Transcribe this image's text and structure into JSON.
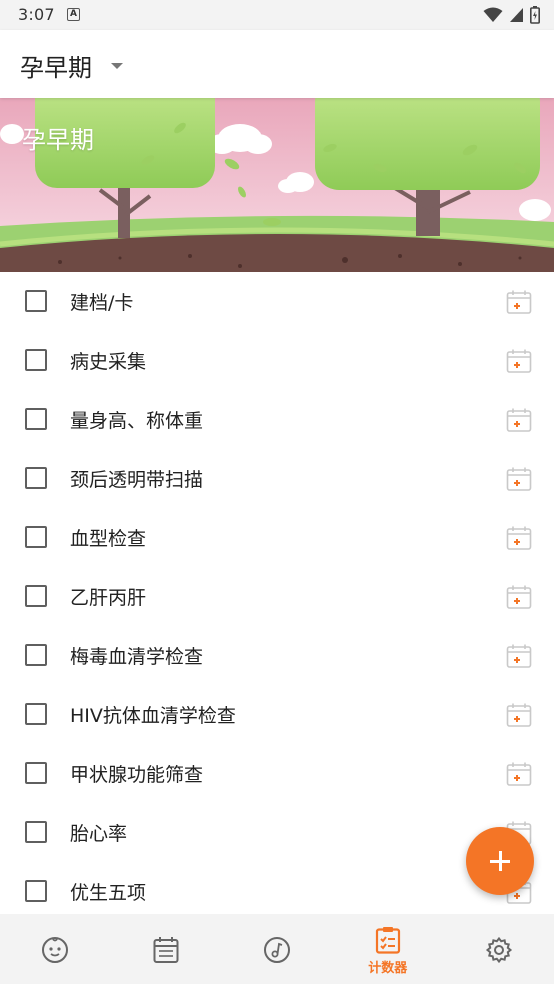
{
  "status_bar": {
    "time": "3:07",
    "notification_icon": "A"
  },
  "app_bar": {
    "period_label": "孕早期"
  },
  "banner": {
    "title": "孕早期"
  },
  "checklist": {
    "items": [
      {
        "label": "建档/卡",
        "checked": false
      },
      {
        "label": "病史采集",
        "checked": false
      },
      {
        "label": "量身高、称体重",
        "checked": false
      },
      {
        "label": "颈后透明带扫描",
        "checked": false
      },
      {
        "label": "血型检查",
        "checked": false
      },
      {
        "label": "乙肝丙肝",
        "checked": false
      },
      {
        "label": "梅毒血清学检查",
        "checked": false
      },
      {
        "label": "HIV抗体血清学检查",
        "checked": false
      },
      {
        "label": "甲状腺功能筛查",
        "checked": false
      },
      {
        "label": "胎心率",
        "checked": false
      },
      {
        "label": "优生五项",
        "checked": false
      }
    ]
  },
  "bottom_nav": {
    "items": [
      {
        "icon": "baby-face-icon",
        "label": ""
      },
      {
        "icon": "calendar-icon",
        "label": ""
      },
      {
        "icon": "music-note-icon",
        "label": ""
      },
      {
        "icon": "checklist-icon",
        "label": "计数器",
        "active": true
      },
      {
        "icon": "gear-icon",
        "label": ""
      }
    ]
  },
  "colors": {
    "accent": "#f47526",
    "banner_pink": "#f3c9d6",
    "tree_green": "#a6d86a",
    "soil": "#6e4a44"
  }
}
